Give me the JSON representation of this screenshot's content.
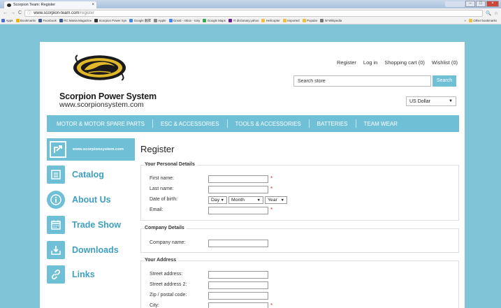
{
  "browser": {
    "tab_title": "Scorpion Team: Register",
    "tab_close": "×",
    "address_host": "www.scorpion-team.com",
    "address_path": "/register",
    "bookmarks": [
      {
        "label": "Apps",
        "color": "#4a6fd1"
      },
      {
        "label": "Bookmarks",
        "color": "#f0b400"
      },
      {
        "label": "Facebook",
        "color": "#3b5998"
      },
      {
        "label": "RC Mania Magazine",
        "color": "#3b5998"
      },
      {
        "label": "Scorpion Power Sys",
        "color": "#333333"
      },
      {
        "label": "Google 翻譯",
        "color": "#4285f4"
      },
      {
        "label": "Apple",
        "color": "#888888"
      },
      {
        "label": "Gmail - Inbox - tony",
        "color": "#4285f4"
      },
      {
        "label": "Google Maps",
        "color": "#34a853"
      },
      {
        "label": "Yt dictionary.yahoo",
        "color": "#6a1b9a"
      },
      {
        "label": "Helicopter",
        "color": "#f0c040"
      },
      {
        "label": "Imported",
        "color": "#f0c040"
      },
      {
        "label": "Popular",
        "color": "#f0c040"
      },
      {
        "label": "W Wikipedia",
        "color": "#777777"
      }
    ],
    "bookmarks_more": "»",
    "other_bookmarks": "Other bookmarks"
  },
  "header": {
    "brand_title": "Scorpion Power System",
    "brand_url": "www.scorpionsystem.com",
    "top_links": [
      "Register",
      "Log in",
      "Shopping cart (0)",
      "Wishlist (0)"
    ],
    "search_placeholder": "Search store",
    "search_button": "Search",
    "currency": "US Dollar"
  },
  "main_nav": [
    "MOTOR & MOTOR SPARE PARTS",
    "ESC & ACCESSORIES",
    "TOOLS & ACCESSORIES",
    "BATTERIES",
    "TEAM WEAR"
  ],
  "sidebar": {
    "site_link": "www.scorpionsystem.com",
    "items": [
      {
        "label": "Catalog",
        "icon": "catalog-icon"
      },
      {
        "label": "About Us",
        "icon": "info-icon"
      },
      {
        "label": "Trade Show",
        "icon": "calendar-icon"
      },
      {
        "label": "Downloads",
        "icon": "download-icon"
      },
      {
        "label": "Links",
        "icon": "link-icon"
      }
    ]
  },
  "form": {
    "page_title": "Register",
    "personal": {
      "title": "Your Personal Details",
      "first_name": "First name:",
      "last_name": "Last name:",
      "dob": "Date of birth:",
      "email": "Email:",
      "day": "Day",
      "month": "Month",
      "year": "Year"
    },
    "company": {
      "title": "Company Details",
      "company_name": "Company name:"
    },
    "address": {
      "title": "Your Address",
      "street": "Street address:",
      "street2": "Street address 2:",
      "zip": "Zip / postal code:",
      "city": "City:"
    },
    "required_mark": "*"
  },
  "colors": {
    "accent": "#6fbfd6",
    "sidebar_text": "#3e9fc0",
    "required": "#e03030",
    "page_background": "#7ec3d6"
  }
}
